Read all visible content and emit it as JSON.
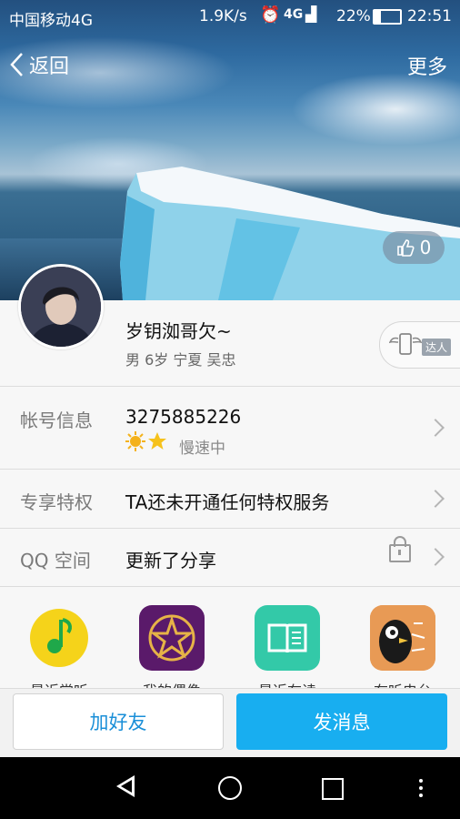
{
  "status_bar": {
    "carrier": "中国移动4G",
    "speed": "1.9K/s",
    "network": "4G",
    "battery": "22%",
    "time": "22:51"
  },
  "nav": {
    "back_label": "返回",
    "more_label": "更多"
  },
  "like_count": "0",
  "profile": {
    "nickname": "岁钥洳哥欠~",
    "info": "男 6岁 宁夏 吴忠",
    "badge": "达人"
  },
  "rows": {
    "account": {
      "label": "帐号信息",
      "value": "3275885226",
      "speed_text": "慢速中"
    },
    "privilege": {
      "label": "专享特权",
      "value": "TA还未开通任何特权服务"
    },
    "qzone": {
      "label": "QQ 空间",
      "value": "更新了分享"
    }
  },
  "apps": [
    {
      "label": "最近常听",
      "icon": "music-note-icon",
      "color": "#f5d31a"
    },
    {
      "label": "我的偶像",
      "icon": "star-idol-icon",
      "color": "#5a1a6a"
    },
    {
      "label": "最近在读",
      "icon": "book-icon",
      "color": "#33c9a8"
    },
    {
      "label": "在听电台",
      "icon": "radio-penguin-icon",
      "color": "#e8a05a"
    }
  ],
  "actions": {
    "add_friend": "加好友",
    "send_message": "发消息"
  },
  "colors": {
    "accent": "#18aef0",
    "link": "#1a8fd8"
  }
}
